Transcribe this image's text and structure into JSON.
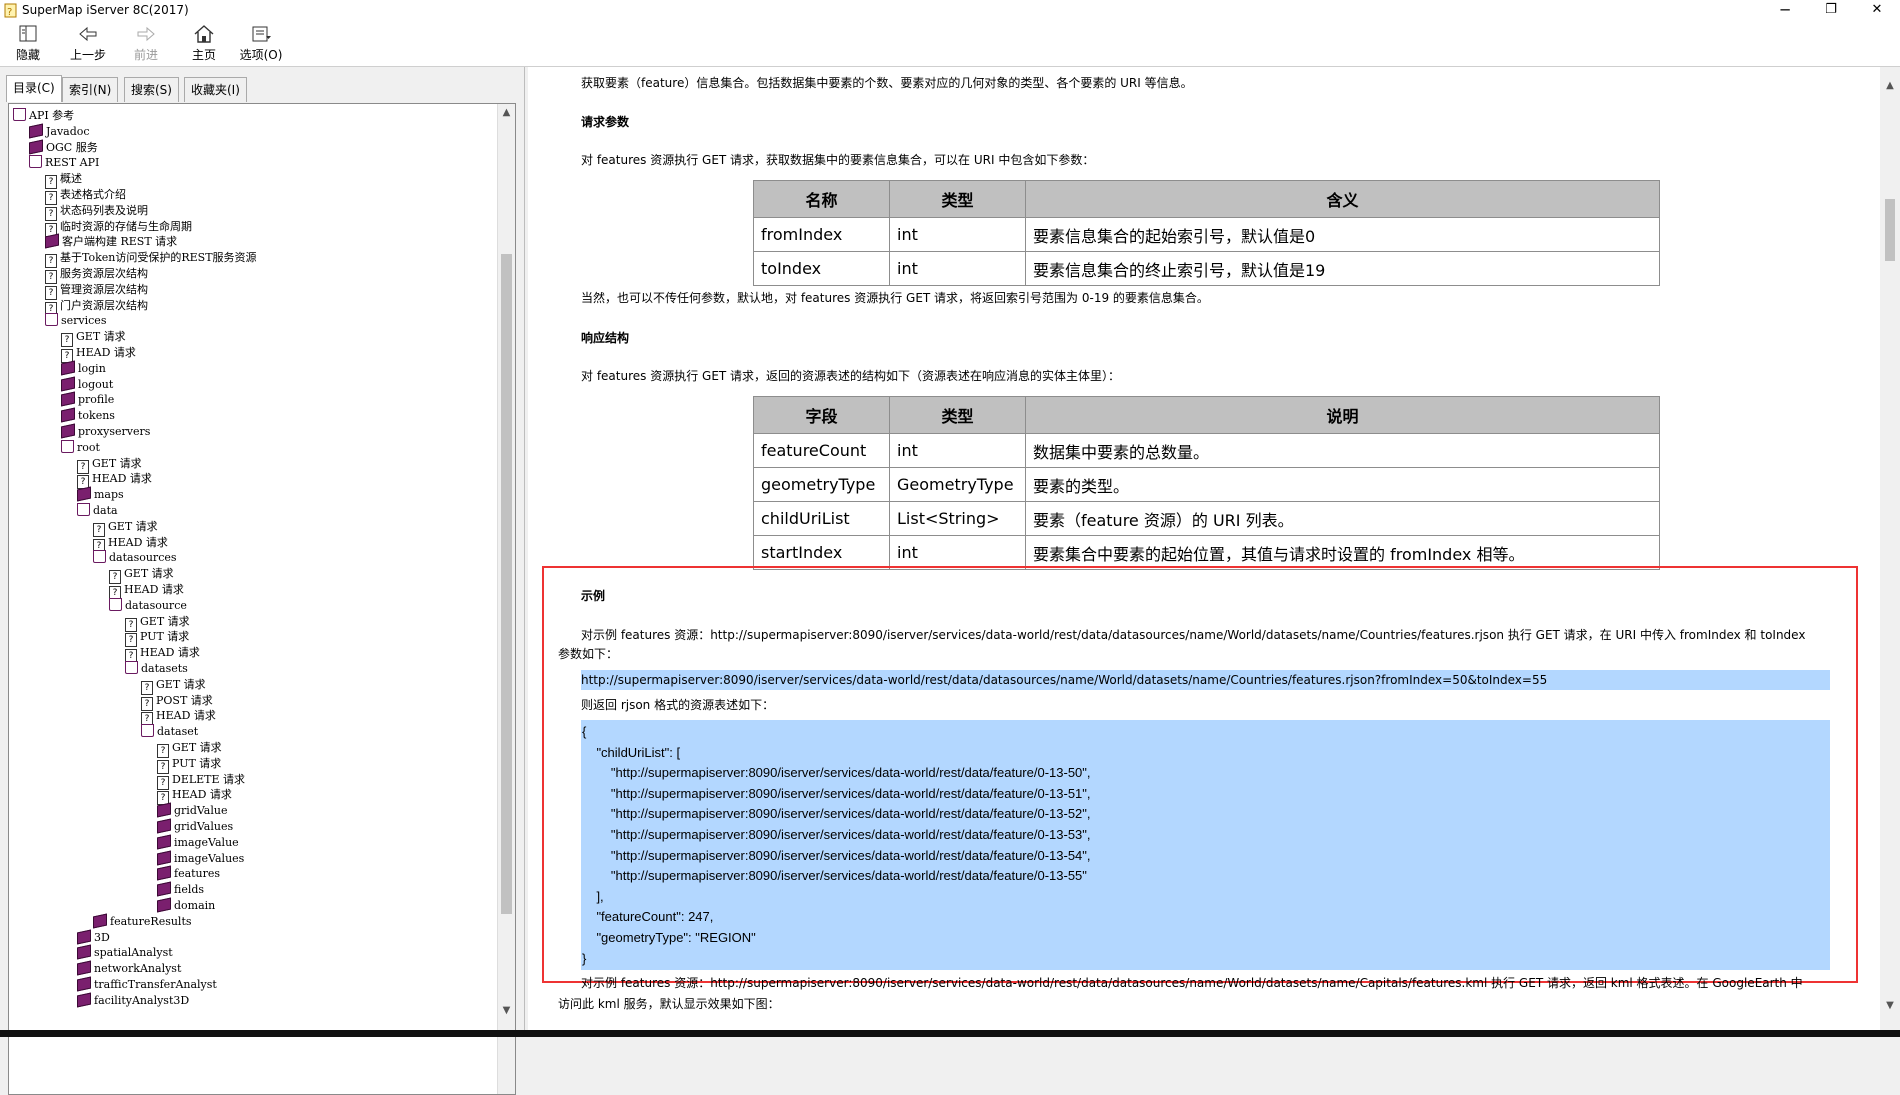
{
  "window": {
    "title": "SuperMap iServer 8C(2017)",
    "minimize": "─",
    "restore": "❐",
    "close": "✕"
  },
  "toolbar": {
    "hide": "隐藏",
    "back": "上一步",
    "forward": "前进",
    "home": "主页",
    "options": "选项(O)"
  },
  "tabs": [
    "目录(C)",
    "索引(N)",
    "搜索(S)",
    "收藏夹(I)"
  ],
  "tree": [
    {
      "label": "API 参考",
      "icon": "openbook",
      "level": 0
    },
    {
      "label": "Javadoc",
      "icon": "book",
      "level": 1
    },
    {
      "label": "OGC 服务",
      "icon": "book",
      "level": 1
    },
    {
      "label": "REST API",
      "icon": "openbook",
      "level": 1
    },
    {
      "label": "概述",
      "icon": "page",
      "level": 2
    },
    {
      "label": "表述格式介绍",
      "icon": "page",
      "level": 2
    },
    {
      "label": "状态码列表及说明",
      "icon": "page",
      "level": 2
    },
    {
      "label": "临时资源的存储与生命周期",
      "icon": "page",
      "level": 2
    },
    {
      "label": "客户端构建 REST 请求",
      "icon": "book",
      "level": 2
    },
    {
      "label": "基于Token访问受保护的REST服务资源",
      "icon": "page",
      "level": 2
    },
    {
      "label": "服务资源层次结构",
      "icon": "page",
      "level": 2
    },
    {
      "label": "管理资源层次结构",
      "icon": "page",
      "level": 2
    },
    {
      "label": "门户资源层次结构",
      "icon": "page",
      "level": 2
    },
    {
      "label": "services",
      "icon": "openbook",
      "level": 2
    },
    {
      "label": "GET 请求",
      "icon": "page",
      "level": 3
    },
    {
      "label": "HEAD 请求",
      "icon": "page",
      "level": 3
    },
    {
      "label": "login",
      "icon": "book",
      "level": 3
    },
    {
      "label": "logout",
      "icon": "book",
      "level": 3
    },
    {
      "label": "profile",
      "icon": "book",
      "level": 3
    },
    {
      "label": "tokens",
      "icon": "book",
      "level": 3
    },
    {
      "label": "proxyservers",
      "icon": "book",
      "level": 3
    },
    {
      "label": "root",
      "icon": "openbook",
      "level": 3
    },
    {
      "label": "GET 请求",
      "icon": "page",
      "level": 4
    },
    {
      "label": "HEAD 请求",
      "icon": "page",
      "level": 4
    },
    {
      "label": "maps",
      "icon": "book",
      "level": 4
    },
    {
      "label": "data",
      "icon": "openbook",
      "level": 4
    },
    {
      "label": "GET 请求",
      "icon": "page",
      "level": 5
    },
    {
      "label": "HEAD 请求",
      "icon": "page",
      "level": 5
    },
    {
      "label": "datasources",
      "icon": "openbook",
      "level": 5
    },
    {
      "label": "GET 请求",
      "icon": "page",
      "level": 6
    },
    {
      "label": "HEAD 请求",
      "icon": "page",
      "level": 6
    },
    {
      "label": "datasource",
      "icon": "openbook",
      "level": 6
    },
    {
      "label": "GET 请求",
      "icon": "page",
      "level": 7
    },
    {
      "label": "PUT 请求",
      "icon": "page",
      "level": 7
    },
    {
      "label": "HEAD 请求",
      "icon": "page",
      "level": 7
    },
    {
      "label": "datasets",
      "icon": "openbook",
      "level": 7
    },
    {
      "label": "GET 请求",
      "icon": "page",
      "level": 8
    },
    {
      "label": "POST 请求",
      "icon": "page",
      "level": 8
    },
    {
      "label": "HEAD 请求",
      "icon": "page",
      "level": 8
    },
    {
      "label": "dataset",
      "icon": "openbook",
      "level": 8
    },
    {
      "label": "GET 请求",
      "icon": "page",
      "level": 9
    },
    {
      "label": "PUT 请求",
      "icon": "page",
      "level": 9
    },
    {
      "label": "DELETE 请求",
      "icon": "page",
      "level": 9
    },
    {
      "label": "HEAD 请求",
      "icon": "page",
      "level": 9
    },
    {
      "label": "gridValue",
      "icon": "book",
      "level": 9
    },
    {
      "label": "gridValues",
      "icon": "book",
      "level": 9
    },
    {
      "label": "imageValue",
      "icon": "book",
      "level": 9
    },
    {
      "label": "imageValues",
      "icon": "book",
      "level": 9
    },
    {
      "label": "features",
      "icon": "book",
      "level": 9
    },
    {
      "label": "fields",
      "icon": "book",
      "level": 9
    },
    {
      "label": "domain",
      "icon": "book",
      "level": 9
    },
    {
      "label": "featureResults",
      "icon": "book",
      "level": 5
    },
    {
      "label": "3D",
      "icon": "book",
      "level": 4
    },
    {
      "label": "spatialAnalyst",
      "icon": "book",
      "level": 4
    },
    {
      "label": "networkAnalyst",
      "icon": "book",
      "level": 4
    },
    {
      "label": "trafficTransferAnalyst",
      "icon": "book",
      "level": 4
    },
    {
      "label": "facilityAnalyst3D",
      "icon": "book",
      "level": 4
    }
  ],
  "content": {
    "intro": "获取要素（feature）信息集合。包括数据集中要素的个数、要素对应的几何对象的类型、各个要素的 URI 等信息。",
    "request_heading": "请求参数",
    "request_desc": "对 features 资源执行 GET 请求，获取数据集中的要素信息集合，可以在 URI 中包含如下参数：",
    "param_table": {
      "headers": [
        "名称",
        "类型",
        "含义"
      ],
      "rows": [
        [
          "fromIndex",
          "int",
          "要素信息集合的起始索引号，默认值是0"
        ],
        [
          "toIndex",
          "int",
          "要素信息集合的终止索引号，默认值是19"
        ]
      ]
    },
    "default_note": "当然，也可以不传任何参数，默认地，对 features 资源执行 GET 请求，将返回索引号范围为 0-19 的要素信息集合。",
    "response_heading": "响应结构",
    "response_desc": "对 features 资源执行 GET 请求，返回的资源表述的结构如下（资源表述在响应消息的实体主体里）：",
    "response_table": {
      "headers": [
        "字段",
        "类型",
        "说明"
      ],
      "rows": [
        [
          "featureCount",
          "int",
          "数据集中要素的总数量。"
        ],
        [
          "geometryType",
          "GeometryType",
          "要素的类型。"
        ],
        [
          "childUriList",
          "List<String>",
          "要素（feature 资源）的 URI 列表。"
        ],
        [
          "startIndex",
          "int",
          "要素集合中要素的起始位置，其值与请求时设置的 fromIndex 相等。"
        ]
      ]
    },
    "example_heading": "示例",
    "example_line1": "对示例 features 资源：http://supermapiserver:8090/iserver/services/data-world/rest/data/datasources/name/World/datasets/name/Countries/features.rjson 执行 GET 请求，在 URI 中传入 fromIndex 和 toIndex",
    "example_line2": "参数如下：",
    "example_url": "http://supermapiserver:8090/iserver/services/data-world/rest/data/datasources/name/World/datasets/name/Countries/features.rjson?fromIndex=50&toIndex=55",
    "return_desc": "则返回 rjson 格式的资源表述如下：",
    "code_lines": [
      "{",
      "    \"childUriList\": [",
      "        \"http://supermapiserver:8090/iserver/services/data-world/rest/data/feature/0-13-50\",",
      "        \"http://supermapiserver:8090/iserver/services/data-world/rest/data/feature/0-13-51\",",
      "        \"http://supermapiserver:8090/iserver/services/data-world/rest/data/feature/0-13-52\",",
      "        \"http://supermapiserver:8090/iserver/services/data-world/rest/data/feature/0-13-53\",",
      "        \"http://supermapiserver:8090/iserver/services/data-world/rest/data/feature/0-13-54\",",
      "        \"http://supermapiserver:8090/iserver/services/data-world/rest/data/feature/0-13-55\"",
      "    ],",
      "    \"featureCount\": 247,",
      "    \"geometryType\": \"REGION\"",
      "}"
    ],
    "kml_line1": "对示例 features 资源：http://supermapiserver:8090/iserver/services/data-world/rest/data/datasources/name/World/datasets/name/Capitals/features.kml 执行 GET 请求，返回 kml 格式表述。在 GoogleEarth 中",
    "kml_line2": "访问此 kml 服务，默认显示效果如下图："
  },
  "colors": {
    "highlight": "#b3d7ff",
    "redbox": "#ee3333",
    "book": "#7a1f6e"
  }
}
